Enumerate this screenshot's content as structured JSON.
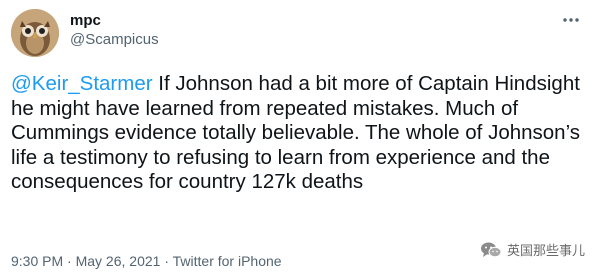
{
  "user": {
    "display_name": "mpc",
    "handle": "@Scampicus",
    "avatar_icon": "owl-avatar-icon"
  },
  "menu": {
    "icon": "more-options-icon"
  },
  "tweet": {
    "mention": "@Keir_Starmer",
    "text": " If Johnson had a bit more of Captain Hindsight he might have learned from repeated mistakes. Much of Cummings evidence totally believable. The whole of Johnson’s life a testimony to refusing to learn from experience and the consequences for country 127k deaths"
  },
  "meta": {
    "time": "9:30 PM",
    "separator1": " · ",
    "date": "May 26, 2021",
    "separator2": " · ",
    "source": "Twitter for iPhone"
  },
  "watermark": {
    "text": "英国那些事儿",
    "icon": "wechat-logo-icon"
  },
  "colors": {
    "link": "#1d9bf0",
    "text": "#0f1419",
    "secondary": "#536471"
  }
}
